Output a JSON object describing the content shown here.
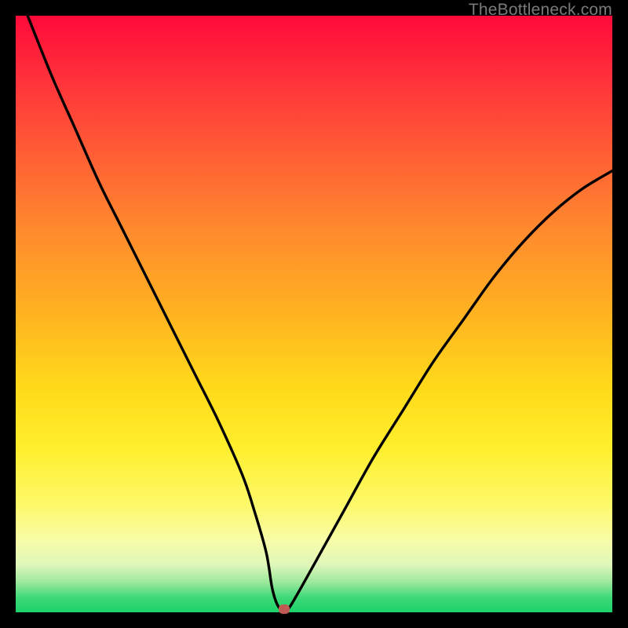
{
  "watermark": "TheBottleneck.com",
  "chart_data": {
    "type": "line",
    "title": "",
    "xlabel": "",
    "ylabel": "",
    "xlim": [
      0,
      100
    ],
    "ylim": [
      0,
      100
    ],
    "grid": false,
    "series": [
      {
        "name": "bottleneck-curve",
        "x": [
          2,
          6,
          10,
          14,
          18,
          22,
          26,
          30,
          34,
          38,
          40,
          42,
          43,
          44,
          45,
          46,
          50,
          55,
          60,
          65,
          70,
          75,
          80,
          85,
          90,
          95,
          100
        ],
        "y": [
          100,
          90,
          81,
          72,
          64,
          56,
          48,
          40,
          32,
          23,
          17,
          10,
          4,
          1,
          0.5,
          1,
          8,
          17,
          26,
          34,
          42,
          49,
          56,
          62,
          67,
          71,
          74
        ]
      }
    ],
    "marker": {
      "x": 45,
      "y": 0.5,
      "color": "#c05a55"
    },
    "background_gradient": {
      "top": "#ff0a3a",
      "mid": "#ffd91a",
      "bottom": "#1bd26a"
    }
  }
}
